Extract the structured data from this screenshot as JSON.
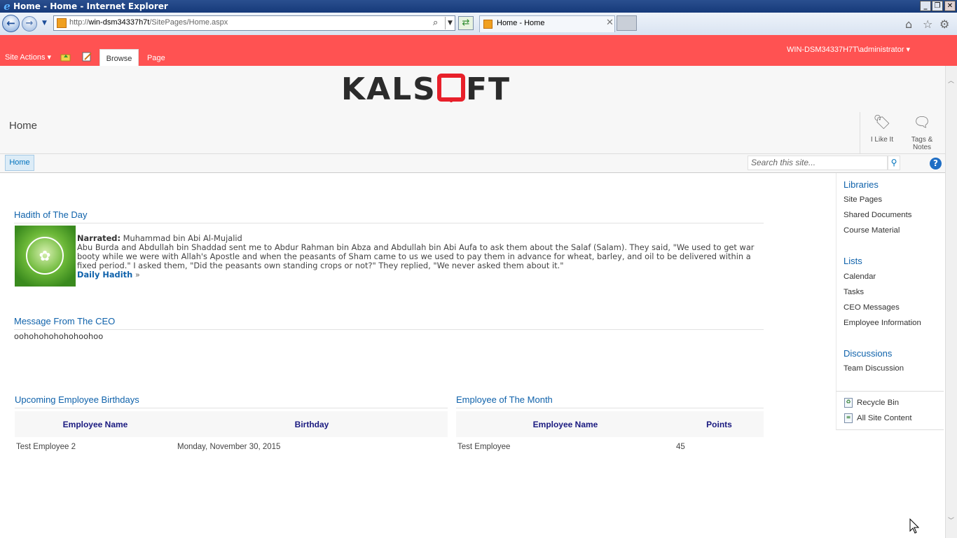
{
  "window": {
    "title": "Home - Home - Internet Explorer",
    "url_prefix": "http://",
    "url_host": "win-dsm34337h7t",
    "url_path": "/SitePages/Home.aspx",
    "tab_label": "Home - Home"
  },
  "ribbon": {
    "site_actions": "Site Actions",
    "tabs": [
      "Browse",
      "Page"
    ],
    "user": "WIN-DSM34337H7T\\administrator"
  },
  "header": {
    "logo": "KALSOFT",
    "page_title": "Home",
    "social": [
      {
        "label": "I Like It",
        "icon": "tag-like-icon"
      },
      {
        "label": "Tags &",
        "label2": "Notes",
        "icon": "tags-notes-icon"
      }
    ]
  },
  "topnav": {
    "home": "Home",
    "search_placeholder": "Search this site..."
  },
  "hadith": {
    "title": "Hadith of The Day",
    "narrated_label": "Narrated:",
    "narrator": "Muhammad bin Abi Al-Mujalid",
    "text": "Abu Burda and Abdullah bin Shaddad sent me to Abdur Rahman bin Abza and Abdullah bin Abi Aufa to ask them about the Salaf (Salam). They said, \"We used to get war booty while we were with Allah's Apostle and when the peasants of Sham came to us we used to pay them in advance for wheat, barley, and oil to be delivered within a fixed period.\" I asked them, \"Did the peasants own standing crops or not?\" They replied, \"We never asked them about it.\"",
    "link": "Daily Hadith",
    "link_suffix": "»"
  },
  "ceo": {
    "title": "Message From The CEO",
    "message": "oohohohohohohoohoo"
  },
  "birthdays": {
    "title": "Upcoming Employee Birthdays",
    "columns": [
      "Employee Name",
      "Birthday"
    ],
    "rows": [
      [
        "Test Employee 2",
        "Monday, November 30, 2015"
      ]
    ]
  },
  "eotm": {
    "title": "Employee of The Month",
    "columns": [
      "Employee Name",
      "Points"
    ],
    "rows": [
      [
        "Test Employee",
        "45"
      ]
    ]
  },
  "quicklaunch": {
    "libraries": {
      "heading": "Libraries",
      "items": [
        "Site Pages",
        "Shared Documents",
        "Course Material"
      ]
    },
    "lists": {
      "heading": "Lists",
      "items": [
        "Calendar",
        "Tasks",
        "CEO Messages",
        "Employee Information"
      ]
    },
    "discussions": {
      "heading": "Discussions",
      "items": [
        "Team Discussion"
      ]
    },
    "bottom": [
      "Recycle Bin",
      "All Site Content"
    ]
  },
  "colors": {
    "ribbon": "#ff5252",
    "link": "#0f62ab",
    "logo_dark": "#2b2b2b",
    "logo_red": "#e8202a"
  }
}
